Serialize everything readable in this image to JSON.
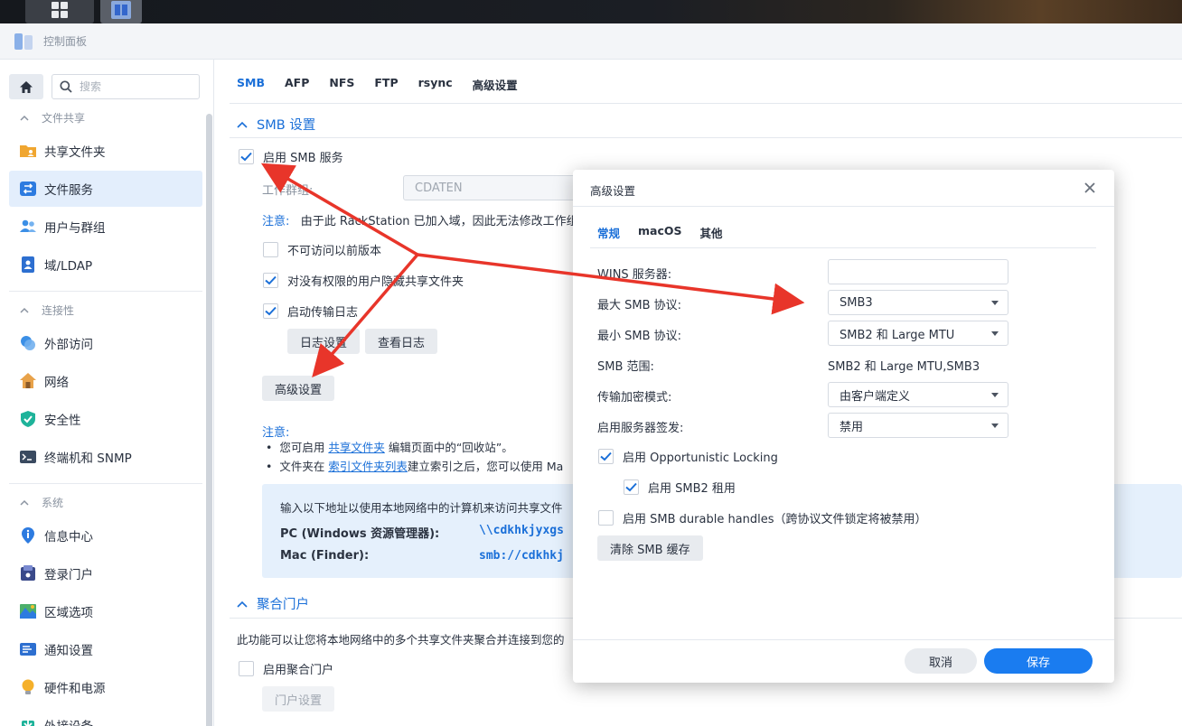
{
  "window": {
    "title": "控制面板"
  },
  "sidebar": {
    "search_placeholder": "搜索",
    "groups": [
      {
        "label": "文件共享",
        "items": [
          {
            "label": "共享文件夹",
            "icon": "folder-share-icon"
          },
          {
            "label": "文件服务",
            "icon": "file-services-icon",
            "active": true
          },
          {
            "label": "用户与群组",
            "icon": "users-icon"
          },
          {
            "label": "域/LDAP",
            "icon": "domain-ldap-icon"
          }
        ]
      },
      {
        "label": "连接性",
        "items": [
          {
            "label": "外部访问",
            "icon": "external-access-icon"
          },
          {
            "label": "网络",
            "icon": "network-icon"
          },
          {
            "label": "安全性",
            "icon": "shield-icon"
          },
          {
            "label": "终端机和 SNMP",
            "icon": "terminal-icon"
          }
        ]
      },
      {
        "label": "系统",
        "items": [
          {
            "label": "信息中心",
            "icon": "info-center-icon"
          },
          {
            "label": "登录门户",
            "icon": "login-portal-icon"
          },
          {
            "label": "区域选项",
            "icon": "regional-options-icon"
          },
          {
            "label": "通知设置",
            "icon": "notification-icon"
          },
          {
            "label": "硬件和电源",
            "icon": "hardware-power-icon"
          },
          {
            "label": "外接设备",
            "icon": "external-devices-icon"
          }
        ]
      }
    ]
  },
  "main": {
    "tabs": [
      "SMB",
      "AFP",
      "NFS",
      "FTP",
      "rsync",
      "高级设置"
    ],
    "active_tab": "SMB",
    "smb": {
      "section_title": "SMB 设置",
      "enable_label": "启用 SMB 服务",
      "enable_checked": true,
      "workgroup_label": "工作群组:",
      "workgroup_value": "CDATEN",
      "note_key": "注意:",
      "note_text": "由于此 RackStation 已加入域，因此无法修改工作组",
      "cb_prev_versions": "不可访问以前版本",
      "cb_prev_versions_checked": false,
      "cb_hide_folders": "对没有权限的用户隐藏共享文件夹",
      "cb_hide_folders_checked": true,
      "cb_transfer_log": "启动传输日志",
      "cb_transfer_log_checked": true,
      "btn_log_settings": "日志设置",
      "btn_view_log": "查看日志",
      "btn_advanced": "高级设置",
      "notes_title": "注意:",
      "bullet1_pre": "您可启用",
      "bullet1_link": "共享文件夹",
      "bullet1_post": "编辑页面中的“回收站”。",
      "bullet2_pre": "文件夹在",
      "bullet2_link": "索引文件夹列表",
      "bullet2_post": "建立索引之后，您可以使用 Ma",
      "info_text": "输入以下地址以使用本地网络中的计算机来访问共享文件",
      "info_pc_label": "PC (Windows 资源管理器):",
      "info_pc_value": "\\\\cdkhkjyxgs",
      "info_mac_label": "Mac (Finder):",
      "info_mac_value": "smb://cdkhkj"
    },
    "portal": {
      "section_title": "聚合门户",
      "desc": "此功能可以让您将本地网络中的多个共享文件夹聚合并连接到您的",
      "enable_label": "启用聚合门户",
      "enable_checked": false,
      "btn_settings": "门户设置"
    }
  },
  "dialog": {
    "title": "高级设置",
    "tabs": [
      "常规",
      "macOS",
      "其他"
    ],
    "active_tab": "常规",
    "form": {
      "wins_label": "WINS 服务器:",
      "wins_value": "",
      "max_smb_label": "最大 SMB 协议:",
      "max_smb_value": "SMB3",
      "min_smb_label": "最小 SMB 协议:",
      "min_smb_value": "SMB2 和 Large MTU",
      "range_label": "SMB 范围:",
      "range_value": "SMB2 和 Large MTU,SMB3",
      "encrypt_label": "传输加密模式:",
      "encrypt_value": "由客户端定义",
      "signing_label": "启用服务器签发:",
      "signing_value": "禁用",
      "oplock_label": "启用 Opportunistic Locking",
      "oplock_checked": true,
      "lease_label": "启用 SMB2 租用",
      "lease_checked": true,
      "durable_label": "启用 SMB durable handles（跨协议文件锁定将被禁用）",
      "durable_checked": false,
      "clear_cache_label": "清除 SMB 缓存"
    },
    "cancel_label": "取消",
    "save_label": "保存"
  },
  "colors": {
    "accent": "#1a6fd8",
    "annotation_arrow": "#e8352a",
    "save_button": "#1a7cf0"
  }
}
